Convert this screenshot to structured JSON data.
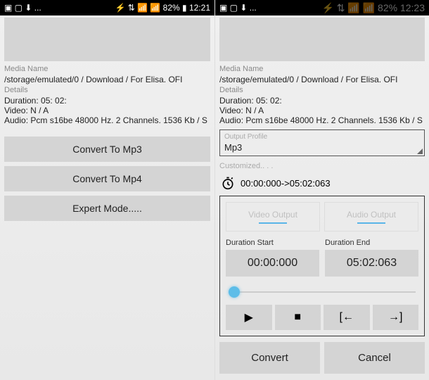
{
  "left": {
    "status": {
      "left": "▣ ▢ ⬇ ...",
      "right": "⚡ ⇅ 📶 📶 82% ▮ 12:21"
    },
    "media_label": "Media Name",
    "media_path": "/storage/emulated/0 / Download / For Elisa. OFI",
    "details_label": "Details",
    "duration": "Duration: 05: 02:",
    "video": "Video: N / A",
    "audio": "Audio: Pcm  s16be 48000 Hz. 2 Channels. 1536 Kb / S",
    "btn_mp3": "Convert To Mp3",
    "btn_mp4": "Convert To Mp4",
    "btn_expert": "Expert Mode....."
  },
  "right": {
    "status": {
      "left": "▣ ▢ ⬇ ...",
      "right": "⚡ ⇅ 📶 📶 82% 12:23"
    },
    "media_label": "Media Name",
    "media_path": "/storage/emulated/0 / Download / For Elisa. OFI",
    "details_label": "Details",
    "duration": "Duration: 05: 02:",
    "video": "Video: N / A",
    "audio": "Audio: Pcm  s16be 48000 Hz. 2 Channels. 1536 Kb / S",
    "output_profile_label": "Output Profile",
    "output_profile_value": "Mp3",
    "customized": "Customized.. . .",
    "time_range": "00:00:000->05:02:063",
    "tab_video": "Video Output",
    "tab_audio": "Audio Output",
    "dur_start_label": "Duration Start",
    "dur_start_value": "00:00:000",
    "dur_end_label": "Duration End",
    "dur_end_value": "05:02:063",
    "ctrl_play": "▶",
    "ctrl_stop": "■",
    "ctrl_in": "[←",
    "ctrl_out": "→]",
    "btn_convert": "Convert",
    "btn_cancel": "Cancel"
  }
}
